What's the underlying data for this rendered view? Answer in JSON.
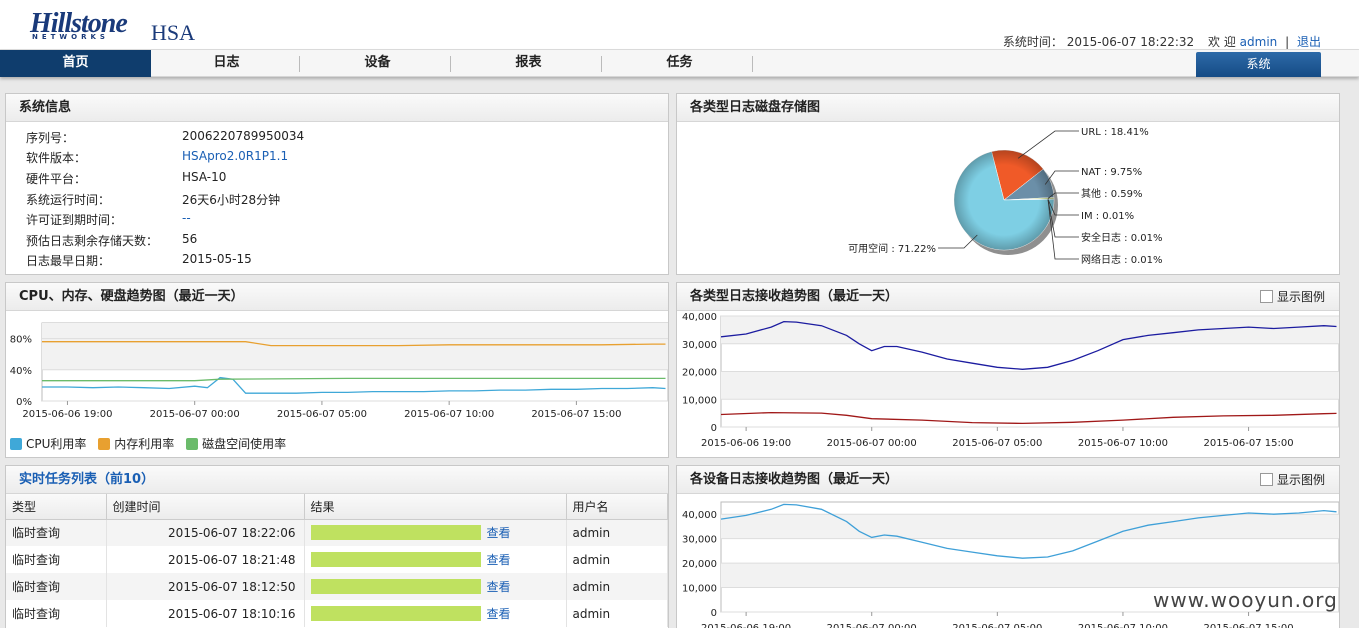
{
  "header": {
    "logo": "Hillstone",
    "logo_sub": "NETWORKS",
    "product": "HSA",
    "time_label": "系统时间：",
    "time_value": "2015-06-07 18:22:32",
    "welcome": "欢 迎",
    "user": "admin",
    "separator": "|",
    "logout": "退出"
  },
  "nav": {
    "items": [
      {
        "label": "首页"
      },
      {
        "label": "日志"
      },
      {
        "label": "设备"
      },
      {
        "label": "报表"
      },
      {
        "label": "任务"
      }
    ],
    "system": "系统"
  },
  "sysinfo": {
    "title": "系统信息",
    "rows": [
      {
        "label": "序列号：",
        "value": "2006220789950034"
      },
      {
        "label": "软件版本：",
        "value": "HSApro2.0R1P1.1"
      },
      {
        "label": "硬件平台：",
        "value": "HSA-10"
      },
      {
        "label": "系统运行时间：",
        "value": "26天6小时28分钟"
      },
      {
        "label": "许可证到期时间：",
        "value": "--"
      },
      {
        "label": "预估日志剩余存储天数：",
        "value": "56"
      },
      {
        "label": "日志最早日期：",
        "value": "2015-05-15"
      }
    ]
  },
  "disk": {
    "title": "各类型日志磁盘存储图"
  },
  "cpu_panel": {
    "title": "CPU、内存、硬盘趋势图（最近一天）",
    "legend": [
      {
        "label": "CPU利用率",
        "color": "#3fa8d8"
      },
      {
        "label": "内存利用率",
        "color": "#e8a030"
      },
      {
        "label": "磁盘空间使用率",
        "color": "#6bbb6b"
      }
    ]
  },
  "recv_panel": {
    "title": "各类型日志接收趋势图（最近一天）",
    "toggle": "显示图例"
  },
  "dev_panel": {
    "title": "各设备日志接收趋势图（最近一天）",
    "toggle": "显示图例"
  },
  "tasks": {
    "title": "实时任务列表（前10）",
    "headers": [
      "类型",
      "创建时间",
      "结果",
      "用户名"
    ],
    "rows": [
      {
        "type": "临时查询",
        "time": "2015-06-07 18:22:06",
        "result": "查看",
        "user": "admin"
      },
      {
        "type": "临时查询",
        "time": "2015-06-07 18:21:48",
        "result": "查看",
        "user": "admin"
      },
      {
        "type": "临时查询",
        "time": "2015-06-07 18:12:50",
        "result": "查看",
        "user": "admin"
      },
      {
        "type": "临时查询",
        "time": "2015-06-07 18:10:16",
        "result": "查看",
        "user": "admin"
      }
    ]
  },
  "watermark": "www.wooyun.org",
  "chart_data": [
    {
      "id": "disk",
      "type": "pie",
      "title": "各类型日志磁盘存储图",
      "slices": [
        {
          "label": "URL : 18.41%",
          "value": 18.41,
          "color": "#f05a28"
        },
        {
          "label": "NAT : 9.75%",
          "value": 9.75,
          "color": "#6b8fa8"
        },
        {
          "label": "其他 : 0.59%",
          "value": 0.59,
          "color": "#c8d890"
        },
        {
          "label": "IM : 0.01%",
          "value": 0.01,
          "color": "#8a9aa8"
        },
        {
          "label": "安全日志 : 0.01%",
          "value": 0.01,
          "color": "#b0c0c8"
        },
        {
          "label": "网络日志 : 0.01%",
          "value": 0.01,
          "color": "#a8b8c0"
        },
        {
          "label": "可用空间 : 71.22%",
          "value": 71.22,
          "color": "#7ecfe4"
        }
      ]
    },
    {
      "id": "cpu",
      "type": "line",
      "title": "CPU、内存、硬盘趋势图（最近一天）",
      "x_ticks": [
        "2015-06-06 19:00",
        "2015-06-07 00:00",
        "2015-06-07 05:00",
        "2015-06-07 10:00",
        "2015-06-07 15:00"
      ],
      "y_ticks": [
        "0%",
        "40%",
        "80%"
      ],
      "ylim": [
        0,
        100
      ],
      "x_hours": [
        18,
        23.5
      ],
      "series": [
        {
          "name": "CPU利用率",
          "color": "#3fa8d8",
          "x": [
            18,
            19,
            20,
            21,
            22,
            23,
            24,
            24.5,
            25,
            25.5,
            26,
            27,
            28,
            29,
            30,
            31,
            32,
            33,
            34,
            35,
            36,
            37,
            38,
            39,
            40,
            41,
            42,
            42.5
          ],
          "y": [
            18,
            18,
            17,
            18,
            17,
            16,
            19,
            17,
            30,
            28,
            10,
            10,
            10,
            11,
            11,
            12,
            12,
            12,
            13,
            13,
            14,
            14,
            15,
            15,
            16,
            16,
            17,
            16
          ]
        },
        {
          "name": "内存利用率",
          "color": "#e8a030",
          "x": [
            18,
            20,
            22,
            24,
            26,
            27,
            28,
            30,
            32,
            34,
            36,
            38,
            40,
            42,
            42.5
          ],
          "y": [
            76,
            76,
            76,
            76,
            76,
            71,
            71,
            71,
            71,
            72,
            72,
            72,
            72,
            73,
            73
          ]
        },
        {
          "name": "磁盘空间使用率",
          "color": "#6bbb6b",
          "x": [
            18,
            22,
            24,
            25,
            30,
            35,
            40,
            42.5
          ],
          "y": [
            26,
            26,
            26,
            28,
            29,
            29,
            29,
            29
          ]
        }
      ]
    },
    {
      "id": "recv",
      "type": "line",
      "title": "各类型日志接收趋势图（最近一天）",
      "x_ticks": [
        "2015-06-06 19:00",
        "2015-06-07 00:00",
        "2015-06-07 05:00",
        "2015-06-07 10:00",
        "2015-06-07 15:00"
      ],
      "y_ticks": [
        "0",
        "10,000",
        "20,000",
        "30,000",
        "40,000"
      ],
      "ylim": [
        0,
        40000
      ],
      "series": [
        {
          "name": "",
          "color": "#1c1ca0",
          "x": [
            18,
            19,
            20,
            20.5,
            21,
            22,
            23,
            23.5,
            24,
            24.5,
            25,
            26,
            27,
            28,
            29,
            30,
            31,
            32,
            33,
            34,
            35,
            36,
            37,
            38,
            39,
            40,
            41,
            42,
            42.5
          ],
          "y": [
            32500,
            33500,
            36000,
            38000,
            37800,
            36500,
            33000,
            30000,
            27500,
            29000,
            29000,
            27000,
            24500,
            23000,
            21500,
            20800,
            21500,
            24000,
            27500,
            31500,
            33000,
            34000,
            35000,
            35500,
            36000,
            35500,
            36000,
            36500,
            36200
          ]
        },
        {
          "name": "",
          "color": "#a01818",
          "x": [
            18,
            20,
            22,
            23,
            24,
            26,
            28,
            30,
            32,
            34,
            36,
            38,
            40,
            42,
            42.5
          ],
          "y": [
            4500,
            5200,
            5000,
            4200,
            3000,
            2500,
            1600,
            1300,
            1700,
            2500,
            3500,
            4000,
            4200,
            4800,
            4900
          ]
        }
      ]
    },
    {
      "id": "dev",
      "type": "line",
      "title": "各设备日志接收趋势图（最近一天）",
      "x_ticks": [
        "2015-06-06 19:00",
        "2015-06-07 00:00",
        "2015-06-07 05:00",
        "2015-06-07 10:00",
        "2015-06-07 15:00"
      ],
      "y_ticks": [
        "0",
        "10,000",
        "20,000",
        "30,000",
        "40,000"
      ],
      "ylim": [
        0,
        45000
      ],
      "series": [
        {
          "name": "",
          "color": "#3fa0d8",
          "x": [
            18,
            19,
            20,
            20.5,
            21,
            22,
            23,
            23.5,
            24,
            24.5,
            25,
            26,
            27,
            28,
            29,
            30,
            31,
            32,
            33,
            34,
            35,
            36,
            37,
            38,
            39,
            40,
            41,
            42,
            42.5
          ],
          "y": [
            38000,
            39500,
            42000,
            44000,
            43800,
            42000,
            37000,
            33000,
            30500,
            31500,
            31000,
            28500,
            26000,
            24500,
            23000,
            22000,
            22500,
            25000,
            29000,
            33000,
            35500,
            37000,
            38500,
            39500,
            40500,
            40000,
            40500,
            41500,
            41000
          ]
        }
      ]
    }
  ]
}
